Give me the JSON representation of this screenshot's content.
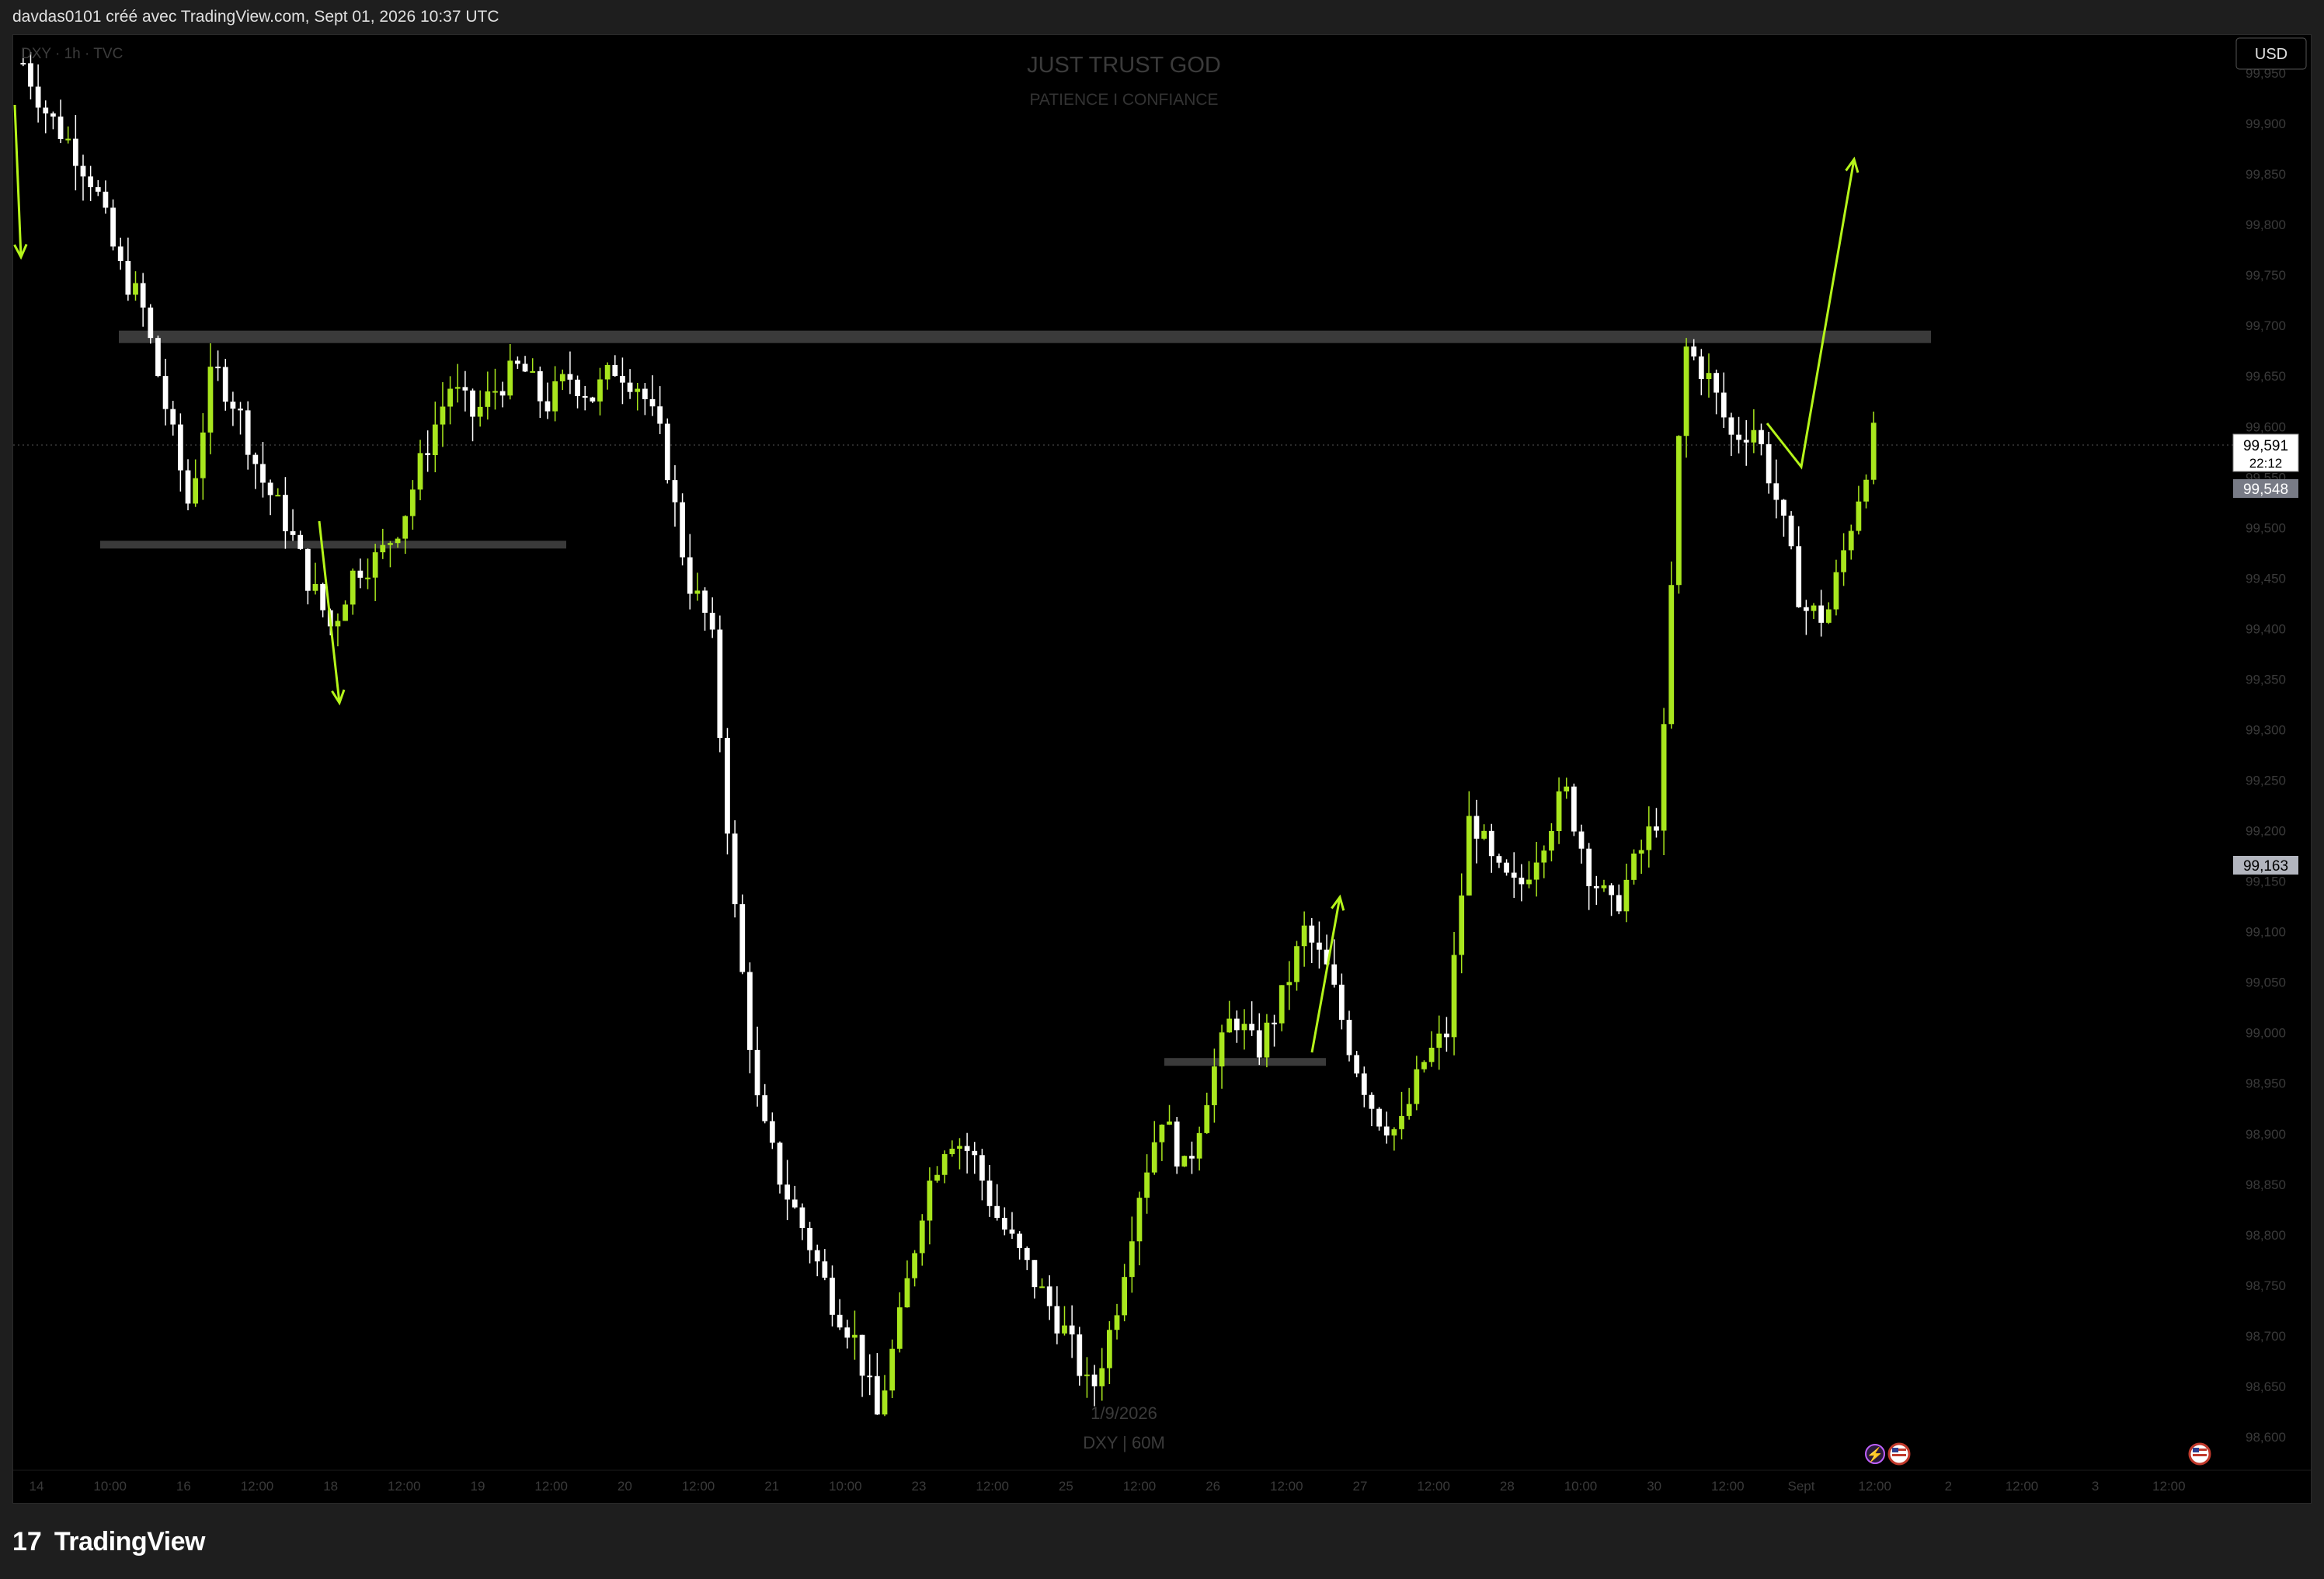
{
  "header": {
    "caption": "davdas0101 créé avec TradingView.com, Sept 01, 2026 10:37 UTC"
  },
  "chart": {
    "symbol_line": "DXY · 1h · TVC",
    "watermark_title": "JUST TRUST GOD",
    "watermark_subtitle": "PATIENCE I CONFIANCE",
    "bottom_date": "1/9/2026",
    "bottom_symbol": "DXY | 60M",
    "currency_button": "USD",
    "last_price_label": "99,591",
    "countdown_label": "22:12",
    "level_label_1": "99,548",
    "level_label_2": "99,163"
  },
  "colors": {
    "bull": "#a8e61d",
    "bear": "#ffffff",
    "zone": "#3a3a3a",
    "arrow": "#b5f51a"
  },
  "footer": {
    "brand": "TradingView",
    "brand_mark": "17"
  },
  "chart_data": {
    "type": "candlestick",
    "title": "",
    "y_range": [
      98.55,
      99.98
    ],
    "y_ticks": [
      "99,950",
      "99,900",
      "99,850",
      "99,800",
      "99,750",
      "99,700",
      "99,650",
      "99,600",
      "99,550",
      "99,500",
      "99,450",
      "99,400",
      "99,350",
      "99,300",
      "99,250",
      "99,200",
      "99,150",
      "99,100",
      "99,050",
      "99,000",
      "98,950",
      "98,900",
      "98,850",
      "98,800",
      "98,750",
      "98,700",
      "98,650",
      "98,600"
    ],
    "x_ticks": [
      "14",
      "10:00",
      "16",
      "12:00",
      "18",
      "12:00",
      "19",
      "12:00",
      "20",
      "12:00",
      "21",
      "10:00",
      "23",
      "12:00",
      "25",
      "12:00",
      "26",
      "12:00",
      "27",
      "12:00",
      "28",
      "10:00",
      "30",
      "12:00",
      "Sept",
      "12:00",
      "2",
      "12:00",
      "3",
      "12:00"
    ],
    "close_path": [
      99.96,
      99.91,
      99.88,
      99.84,
      99.76,
      99.72,
      99.62,
      99.52,
      99.66,
      99.62,
      99.55,
      99.51,
      99.45,
      99.4,
      99.46,
      99.47,
      99.51,
      99.58,
      99.64,
      99.61,
      99.64,
      99.66,
      99.62,
      99.65,
      99.63,
      99.66,
      99.64,
      99.58,
      99.45,
      99.4,
      99.12,
      98.92,
      98.85,
      98.8,
      98.74,
      98.7,
      98.62,
      98.72,
      98.84,
      98.9,
      98.88,
      98.82,
      98.78,
      98.74,
      98.7,
      98.64,
      98.72,
      98.84,
      98.92,
      98.86,
      98.95,
      99.02,
      98.98,
      99.03,
      99.1,
      99.06,
      98.98,
      98.92,
      98.9,
      98.97,
      99.0,
      99.22,
      99.16,
      99.14,
      99.19,
      99.24,
      99.16,
      99.12,
      99.17,
      99.22,
      99.68,
      99.65,
      99.59,
      99.6,
      99.52,
      99.42,
      99.41,
      99.5,
      99.59
    ],
    "current_price": 99.591,
    "horizontal_levels": [
      99.548,
      99.163
    ]
  }
}
